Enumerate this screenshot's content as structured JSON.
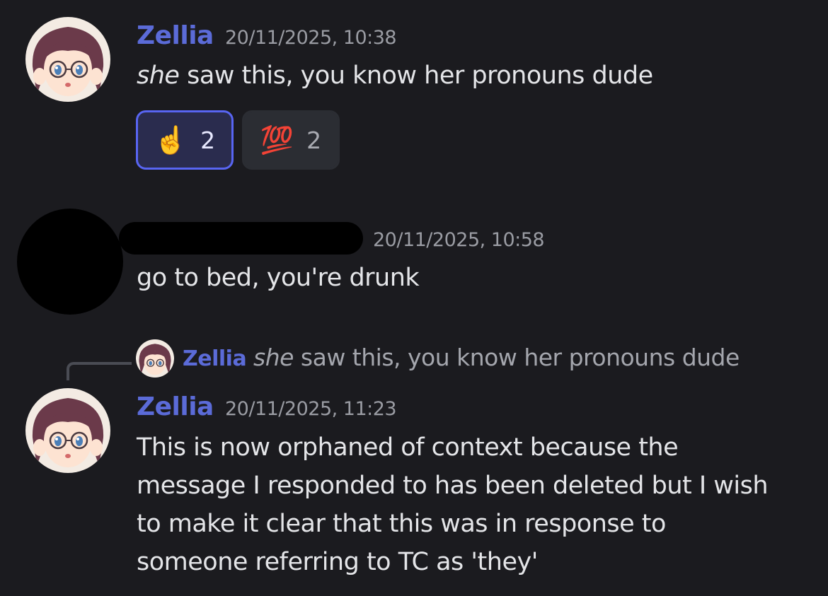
{
  "messages": [
    {
      "author": "Zellia",
      "timestamp": "20/11/2025, 10:38",
      "text_em": "she",
      "text_rest": " saw this, you know her pronouns dude",
      "reactions": [
        {
          "emoji": "☝️",
          "icon": "pointing-up-icon",
          "count": "2",
          "active": true
        },
        {
          "emoji": "💯",
          "icon": "hundred-points-icon",
          "count": "2",
          "active": false
        }
      ]
    },
    {
      "author": "",
      "author_redacted": true,
      "timestamp": "20/11/2025, 10:58",
      "text": "go to bed, you're drunk"
    },
    {
      "reply": {
        "author": "Zellia",
        "text_em": "she",
        "text_rest": " saw this, you know her pronouns dude"
      },
      "author": "Zellia",
      "timestamp": "20/11/2025, 11:23",
      "lines": [
        "This is now orphaned of context because the",
        "message I responded to has been deleted but I wish",
        "to make it clear that this was in response to",
        "someone referring to TC as 'they'"
      ]
    }
  ],
  "colors": {
    "background": "#1b1b1f",
    "username": "#5b6bd8",
    "timestamp": "#9a9ca3",
    "reaction_active_border": "#5865f2"
  }
}
